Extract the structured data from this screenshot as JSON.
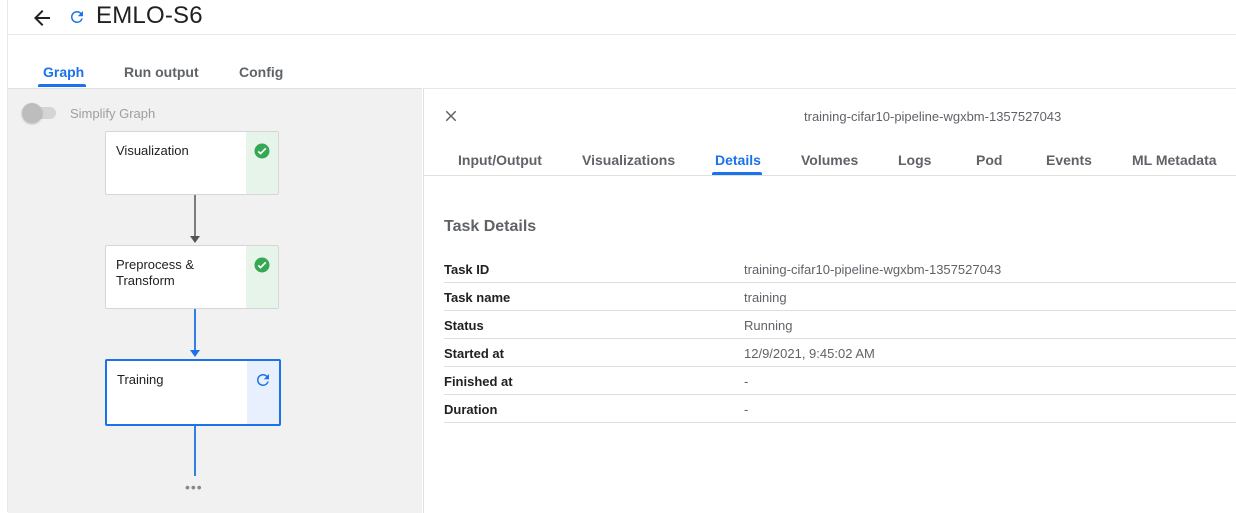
{
  "header": {
    "title": "EMLO-S6",
    "back_icon": "arrow-back-icon",
    "status_icon": "running-refresh-icon"
  },
  "top_tabs": [
    {
      "label": "Graph",
      "active": true
    },
    {
      "label": "Run output",
      "active": false
    },
    {
      "label": "Config",
      "active": false
    }
  ],
  "graph": {
    "simplify_label": "Simplify Graph",
    "simplify_enabled": false,
    "nodes": [
      {
        "label": "Visualization",
        "status": "succeeded"
      },
      {
        "label": "Preprocess & Transform",
        "status": "succeeded"
      },
      {
        "label": "Training",
        "status": "running",
        "selected": true
      }
    ],
    "more_indicator": "•••"
  },
  "details": {
    "pod_name": "training-cifar10-pipeline-wgxbm-1357527043",
    "tabs": [
      {
        "label": "Input/Output",
        "active": false
      },
      {
        "label": "Visualizations",
        "active": false
      },
      {
        "label": "Details",
        "active": true
      },
      {
        "label": "Volumes",
        "active": false
      },
      {
        "label": "Logs",
        "active": false
      },
      {
        "label": "Pod",
        "active": false
      },
      {
        "label": "Events",
        "active": false
      },
      {
        "label": "ML Metadata",
        "active": false
      }
    ],
    "section_title": "Task Details",
    "rows": [
      {
        "key": "Task ID",
        "value": "training-cifar10-pipeline-wgxbm-1357527043"
      },
      {
        "key": "Task name",
        "value": "training"
      },
      {
        "key": "Status",
        "value": "Running"
      },
      {
        "key": "Started at",
        "value": "12/9/2021, 9:45:02 AM"
      },
      {
        "key": "Finished at",
        "value": "-"
      },
      {
        "key": "Duration",
        "value": "-"
      }
    ]
  },
  "colors": {
    "accent": "#1a73e8",
    "success": "#34a853",
    "success_bg": "#e6f4ea",
    "running_bg": "#e8f0fe"
  }
}
